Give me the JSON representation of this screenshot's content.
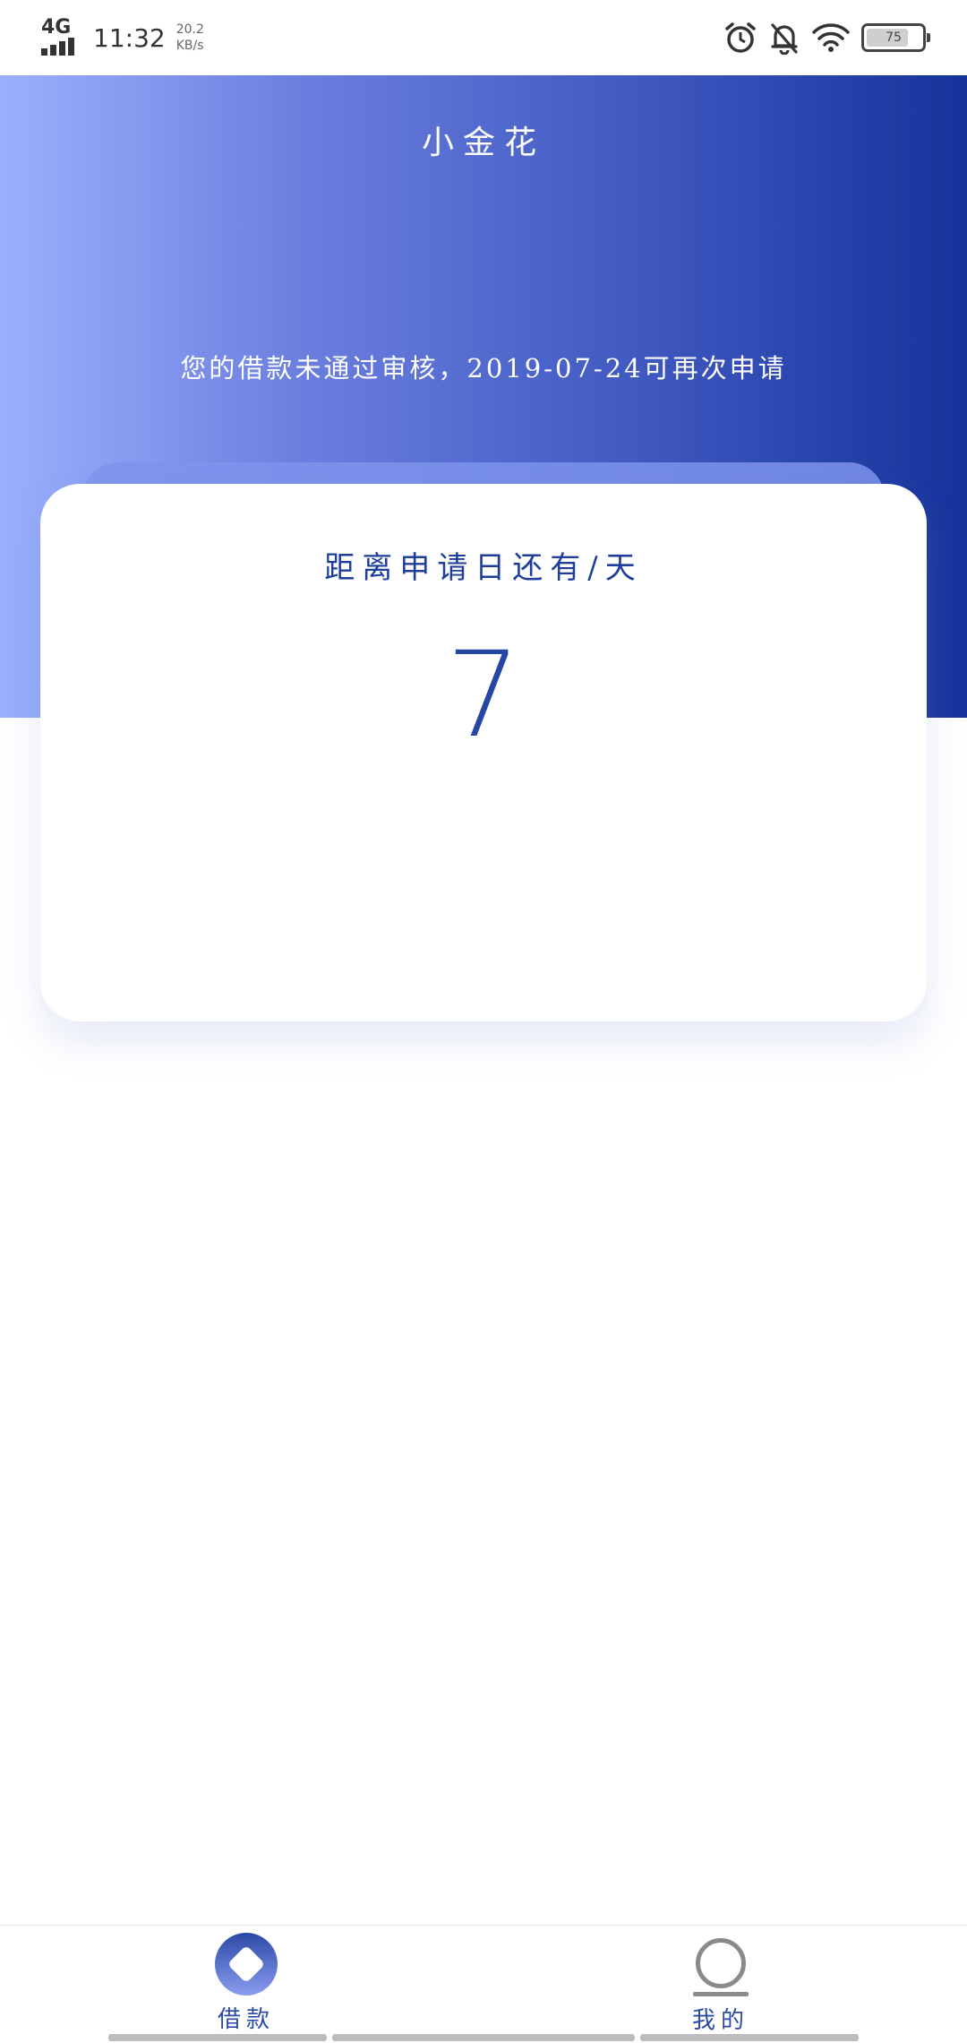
{
  "status_bar": {
    "network": "4G",
    "time": "11:32",
    "speed_value": "20.2",
    "speed_unit": "KB/s",
    "battery": "75"
  },
  "header": {
    "title": "小金花"
  },
  "notice": {
    "message": "您的借款未通过审核，2019-07-24可再次申请"
  },
  "countdown": {
    "label": "距离申请日还有/天",
    "days": "7"
  },
  "tabs": [
    {
      "label": "借款",
      "icon": "loan-diamond-icon",
      "active": true
    },
    {
      "label": "我的",
      "icon": "profile-icon",
      "active": false
    }
  ],
  "colors": {
    "accent": "#2646a3",
    "gradient_start": "#9bb0fc",
    "gradient_end": "#16339a",
    "inactive": "#8a8a8a"
  }
}
